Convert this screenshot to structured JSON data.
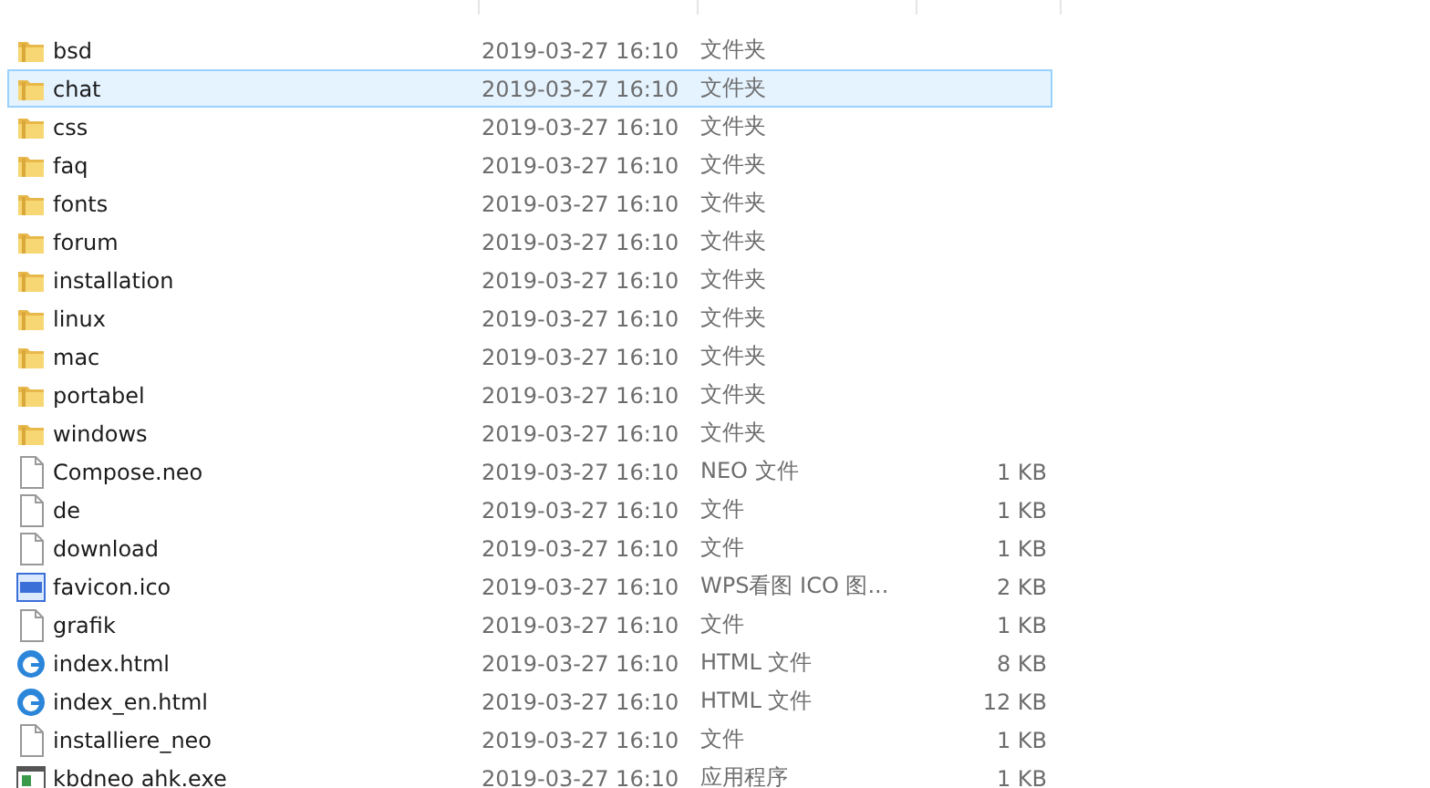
{
  "files": [
    {
      "name": "bsd",
      "date": "2019-03-27 16:10",
      "type": "文件夹",
      "kind": "folder",
      "selected": false
    },
    {
      "name": "chat",
      "date": "2019-03-27 16:10",
      "type": "文件夹",
      "kind": "folder",
      "selected": true
    },
    {
      "name": "css",
      "date": "2019-03-27 16:10",
      "type": "文件夹",
      "kind": "folder",
      "selected": false
    },
    {
      "name": "faq",
      "date": "2019-03-27 16:10",
      "type": "文件夹",
      "kind": "folder",
      "selected": false
    },
    {
      "name": "fonts",
      "date": "2019-03-27 16:10",
      "type": "文件夹",
      "kind": "folder",
      "selected": false
    },
    {
      "name": "forum",
      "date": "2019-03-27 16:10",
      "type": "文件夹",
      "kind": "folder",
      "selected": false
    },
    {
      "name": "installation",
      "date": "2019-03-27 16:10",
      "type": "文件夹",
      "kind": "folder",
      "selected": false
    },
    {
      "name": "linux",
      "date": "2019-03-27 16:10",
      "type": "文件夹",
      "kind": "folder",
      "selected": false
    },
    {
      "name": "mac",
      "date": "2019-03-27 16:10",
      "type": "文件夹",
      "kind": "folder",
      "selected": false
    },
    {
      "name": "portabel",
      "date": "2019-03-27 16:10",
      "type": "文件夹",
      "kind": "folder",
      "selected": false
    },
    {
      "name": "windows",
      "date": "2019-03-27 16:10",
      "type": "文件夹",
      "kind": "folder",
      "selected": false
    },
    {
      "name": "Compose.neo",
      "date": "2019-03-27 16:10",
      "type": "NEO 文件",
      "size": "1 KB",
      "kind": "file",
      "selected": false
    },
    {
      "name": "de",
      "date": "2019-03-27 16:10",
      "type": "文件",
      "size": "1 KB",
      "kind": "file",
      "selected": false
    },
    {
      "name": "download",
      "date": "2019-03-27 16:10",
      "type": "文件",
      "size": "1 KB",
      "kind": "file",
      "selected": false
    },
    {
      "name": "favicon.ico",
      "date": "2019-03-27 16:10",
      "type": "WPS看图 ICO 图...",
      "size": "2 KB",
      "kind": "image",
      "selected": false
    },
    {
      "name": "grafik",
      "date": "2019-03-27 16:10",
      "type": "文件",
      "size": "1 KB",
      "kind": "file",
      "selected": false
    },
    {
      "name": "index.html",
      "date": "2019-03-27 16:10",
      "type": "HTML 文件",
      "size": "8 KB",
      "kind": "html",
      "selected": false
    },
    {
      "name": "index_en.html",
      "date": "2019-03-27 16:10",
      "type": "HTML 文件",
      "size": "12 KB",
      "kind": "html",
      "selected": false
    },
    {
      "name": "installiere_neo",
      "date": "2019-03-27 16:10",
      "type": "文件",
      "size": "1 KB",
      "kind": "file",
      "selected": false
    },
    {
      "name": "kbdneo ahk.exe",
      "date": "2019-03-27 16:10",
      "type": "应用程序",
      "size": "1 KB",
      "kind": "exe",
      "selected": false
    }
  ]
}
